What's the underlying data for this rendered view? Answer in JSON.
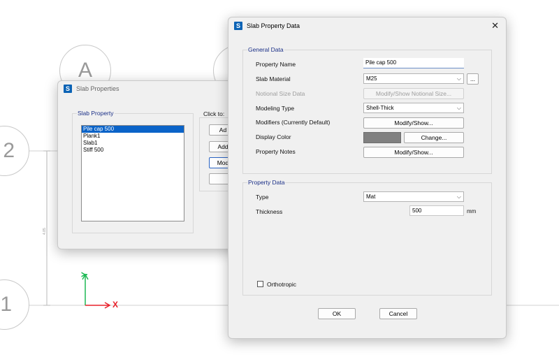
{
  "canvas": {
    "grid_bubbles": {
      "a": "A",
      "two": "2",
      "one": "1"
    },
    "dimension_text": "4.85",
    "axis_labels": {
      "y": "Y",
      "x": "X"
    }
  },
  "slab_properties": {
    "title": "Slab Properties",
    "app_icon": "S",
    "group_label": "Slab Property",
    "click_to_label": "Click to:",
    "items": [
      "Pile cap 500",
      "Plank1",
      "Slab1",
      "Stiff 500"
    ],
    "selected_index": 0,
    "buttons": [
      "Ad",
      "Add",
      "Mod",
      ""
    ]
  },
  "slab_property_data": {
    "title": "Slab Property Data",
    "app_icon": "S",
    "close_icon": "close-icon",
    "general_data": {
      "label": "General Data",
      "property_name_label": "Property Name",
      "property_name_value": "Pile cap 500",
      "slab_material_label": "Slab Material",
      "slab_material_value": "M25",
      "ellipsis_label": "...",
      "notional_size_label": "Notional Size Data",
      "notional_size_button": "Modify/Show Notional Size...",
      "modeling_type_label": "Modeling Type",
      "modeling_type_value": "Shell-Thick",
      "modifiers_label": "Modifiers (Currently Default)",
      "modifiers_button": "Modify/Show...",
      "display_color_label": "Display Color",
      "display_color_value": "#808080",
      "change_button": "Change...",
      "property_notes_label": "Property Notes",
      "property_notes_button": "Modify/Show..."
    },
    "property_data": {
      "label": "Property Data",
      "type_label": "Type",
      "type_value": "Mat",
      "thickness_label": "Thickness",
      "thickness_value": "500",
      "thickness_unit": "mm",
      "orthotropic_label": "Orthotropic",
      "orthotropic_checked": false
    },
    "ok_button": "OK",
    "cancel_button": "Cancel"
  },
  "colors": {
    "accent": "#0a63c8",
    "group_label": "#1a2f87",
    "axis_y": "#1db954",
    "axis_x": "#e8202a"
  }
}
